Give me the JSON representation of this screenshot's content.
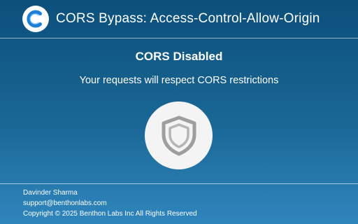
{
  "header": {
    "title": "CORS Bypass: Access-Control-Allow-Origin",
    "logo_icon": "extension-logo-c"
  },
  "status": {
    "title": "CORS Disabled",
    "description": "Your requests will respect CORS restrictions",
    "icon": "shield-icon",
    "enabled": false
  },
  "footer": {
    "author": "Davinder Sharma",
    "email": "support@benthonlabs.com",
    "copyright": "Copyright © 2025 Benthon Labs Inc All Rights Reserved"
  },
  "colors": {
    "background_top": "#0c4f7b",
    "background_bottom": "#2f86bd",
    "logo_blue": "#1e7fd8",
    "shield_gray": "#9e9e9e"
  }
}
